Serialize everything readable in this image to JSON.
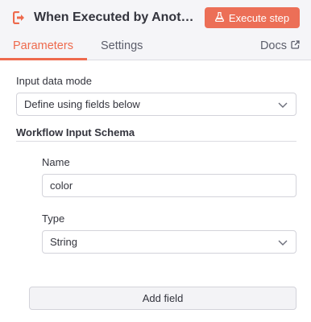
{
  "header": {
    "node_title": "When Executed by Another Workflow",
    "node_icon": "sign-in-arrow-icon",
    "execute_label": "Execute step",
    "execute_icon": "flask-icon"
  },
  "tabs": [
    {
      "label": "Parameters",
      "active": true
    },
    {
      "label": "Settings",
      "active": false
    }
  ],
  "docs": {
    "label": "Docs",
    "icon": "external-link-icon"
  },
  "input_data_mode": {
    "label": "Input data mode",
    "value": "Define using fields below"
  },
  "schema": {
    "title": "Workflow Input Schema",
    "name_label": "Name",
    "name_value": "color",
    "type_label": "Type",
    "type_value": "String"
  },
  "add_field_label": "Add field",
  "colors": {
    "accent": "#ee6a4d",
    "button_bg": "#ec6f57",
    "header_bg": "#f5f5f8"
  }
}
